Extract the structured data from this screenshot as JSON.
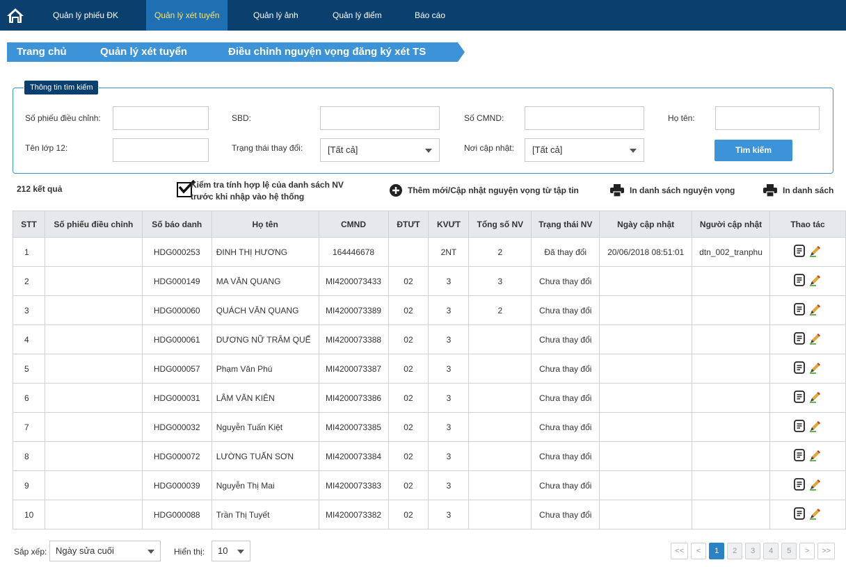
{
  "nav": {
    "items": [
      {
        "label": "Quản lý phiếu ĐK"
      },
      {
        "label": "Quản lý xét tuyển"
      },
      {
        "label": "Quản lý ảnh"
      },
      {
        "label": "Quản lý điểm"
      },
      {
        "label": "Báo cáo"
      }
    ],
    "active_index": 1
  },
  "breadcrumb": {
    "items": [
      "Trang chủ",
      "Quản lý xét tuyển",
      "Điều chỉnh nguyện vọng đăng ký xét TS"
    ]
  },
  "search": {
    "legend": "Thông tin tìm kiếm",
    "so_phieu_label": "Số phiếu điều chỉnh:",
    "sbd_label": "SBD:",
    "cmnd_label": "Số CMND:",
    "ho_ten_label": "Họ tên:",
    "ten_lop_label": "Tên lớp 12:",
    "trang_thai_label": "Trạng thái thay đổi:",
    "trang_thai_value": "[Tất cả]",
    "noi_cap_nhat_label": "Nơi cập nhật:",
    "noi_cap_nhat_value": "[Tất cả]",
    "button": "Tìm kiếm"
  },
  "toolbar": {
    "result_count": "212 kết quả",
    "check_line1": "Kiểm tra tính hợp lệ của danh sách NV",
    "check_line2": "trước khi nhập vào hệ thống",
    "add_label": "Thêm mới/Cập nhật nguyện vọng từ tập tin",
    "print_nv_label": "In danh sách nguyện vọng",
    "print_label": "In danh sách"
  },
  "table": {
    "headers": [
      "STT",
      "Số phiếu điều chỉnh",
      "Số báo danh",
      "Họ tên",
      "CMND",
      "ĐTƯT",
      "KVƯT",
      "Tổng số NV",
      "Trạng thái NV",
      "Ngày cập nhật",
      "Người cập nhật",
      "Thao tác"
    ],
    "rows": [
      [
        "1",
        "",
        "HDG000253",
        "ĐINH THỊ HƯƠNG",
        "164446678",
        "",
        "2NT",
        "2",
        "Đã thay đổi",
        "20/06/2018 08:51:01",
        "dtn_002_tranphu"
      ],
      [
        "2",
        "",
        "HDG000149",
        "MA VĂN QUANG",
        "MI4200073433",
        "02",
        "3",
        "3",
        "Chưa thay đổi",
        "",
        ""
      ],
      [
        "3",
        "",
        "HDG000060",
        "QUÁCH VĂN QUANG",
        "MI4200073389",
        "02",
        "3",
        "2",
        "Chưa thay đổi",
        "",
        ""
      ],
      [
        "4",
        "",
        "HDG000061",
        "DƯƠNG NỮ TRÂM QUẾ",
        "MI4200073388",
        "02",
        "3",
        "",
        "Chưa thay đổi",
        "",
        ""
      ],
      [
        "5",
        "",
        "HDG000057",
        "Phạm Văn Phú",
        "MI4200073387",
        "02",
        "3",
        "",
        "Chưa thay đổi",
        "",
        ""
      ],
      [
        "6",
        "",
        "HDG000031",
        "LÂM VĂN KIÊN",
        "MI4200073386",
        "02",
        "3",
        "",
        "Chưa thay đổi",
        "",
        ""
      ],
      [
        "7",
        "",
        "HDG000032",
        "Nguyễn Tuấn Kiệt",
        "MI4200073385",
        "02",
        "3",
        "",
        "Chưa thay đổi",
        "",
        ""
      ],
      [
        "8",
        "",
        "HDG000072",
        "LƯỜNG TUẤN SƠN",
        "MI4200073384",
        "02",
        "3",
        "",
        "Chưa thay đổi",
        "",
        ""
      ],
      [
        "9",
        "",
        "HDG000039",
        "Nguyễn Thị Mai",
        "MI4200073383",
        "02",
        "3",
        "",
        "Chưa thay đổi",
        "",
        ""
      ],
      [
        "10",
        "",
        "HDG000088",
        "Trần Thị Tuyết",
        "MI4200073382",
        "02",
        "3",
        "",
        "Chưa thay đổi",
        "",
        ""
      ]
    ]
  },
  "footer": {
    "sort_label": "Sắp xếp:",
    "sort_value": "Ngày sửa cuối",
    "show_label": "Hiển thị:",
    "show_value": "10",
    "pager": [
      "<<",
      "<",
      "1",
      "2",
      "3",
      "4",
      "5",
      ">",
      ">>"
    ],
    "current_page": "1"
  },
  "colors": {
    "nav_bg": "#0b3f6e",
    "accent": "#3d93d8",
    "active_nav_text": "#ffe36a",
    "header_bg": "#e5e8ec"
  },
  "icons": [
    "home-icon",
    "checkbox-icon",
    "plus-circle-icon",
    "printer-icon",
    "document-icon",
    "edit-pencil-icon"
  ]
}
